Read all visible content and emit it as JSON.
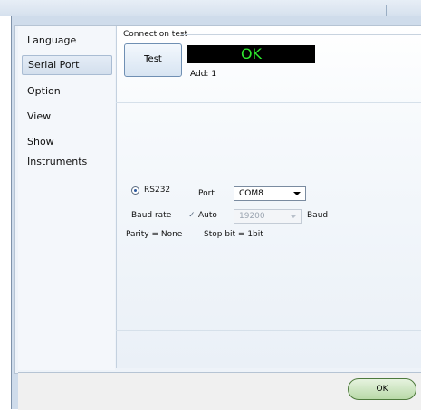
{
  "sidebar": {
    "items": [
      {
        "label": "Language"
      },
      {
        "label": "Serial Port"
      },
      {
        "label": "Option"
      },
      {
        "label": "View"
      },
      {
        "label": "Show Instruments"
      }
    ]
  },
  "connection": {
    "group_title": "Connection test",
    "test_button": "Test",
    "status": "OK",
    "status_color": "#2de82d",
    "address": "Add: 1"
  },
  "serial": {
    "rs232_label": "RS232",
    "port_label": "Port",
    "port_value": "COM8",
    "baud_rate_label": "Baud rate",
    "auto_label": "Auto",
    "auto_checked": true,
    "baud_value": "19200",
    "baud_unit": "Baud",
    "parity": "Parity = None",
    "stop_bit": "Stop bit = 1bit"
  },
  "footer": {
    "ok_button": "OK"
  }
}
